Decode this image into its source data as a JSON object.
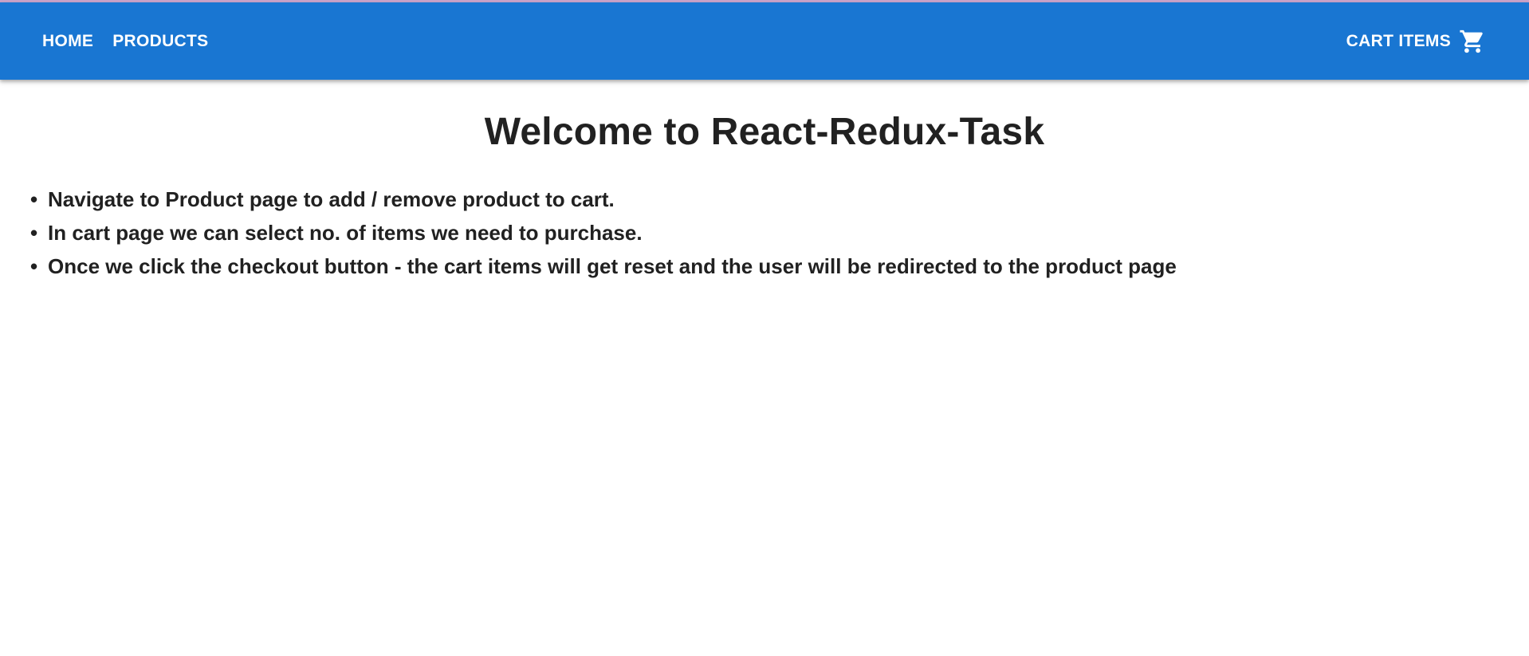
{
  "nav": {
    "home_label": "HOME",
    "products_label": "PRODUCTS",
    "cart_label": "CART ITEMS",
    "cart_icon": "shopping-cart-icon"
  },
  "colors": {
    "appbar": "#1976d2",
    "nav_text": "#ffffff",
    "body_text": "#212121"
  },
  "main": {
    "title": "Welcome to React-Redux-Task",
    "bullet": "•",
    "items": [
      "Navigate to Product page to add / remove product to cart.",
      "In cart page we can select no. of items we need to purchase.",
      "Once we click the checkout button - the cart items will get reset and the user will be redirected to the product page"
    ]
  }
}
